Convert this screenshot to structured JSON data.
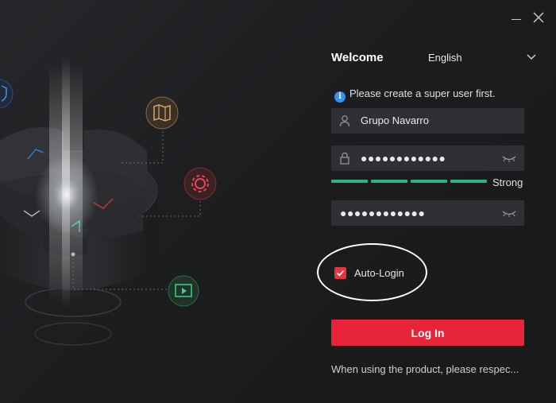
{
  "window": {
    "controls": [
      "minimize-icon",
      "close-icon"
    ]
  },
  "header": {
    "title": "Welcome",
    "language": "English"
  },
  "info": {
    "text": "Please create a super user first."
  },
  "form": {
    "username": "Grupo Navarro",
    "password": "●●●●●●●●●●●●",
    "confirm_password": "●●●●●●●●●●●●",
    "strength_label": "Strong",
    "strength_segments": 4,
    "auto_login_label": "Auto-Login",
    "auto_login_checked": true,
    "login_button": "Log In"
  },
  "footer": {
    "text": "When using the product, please respec..."
  },
  "colors": {
    "accent_red": "#e8243b",
    "strength_green": "#2fb27d",
    "info_blue": "#3b8ff0",
    "background": "#1b1c1e",
    "field_bg": "#2f3033"
  },
  "icons": [
    "map-icon",
    "gear-icon",
    "video-icon",
    "shield-icon",
    "user-icon",
    "lock-icon",
    "eye-closed-icon",
    "info-icon",
    "chevron-down-icon",
    "checkmark-icon"
  ]
}
